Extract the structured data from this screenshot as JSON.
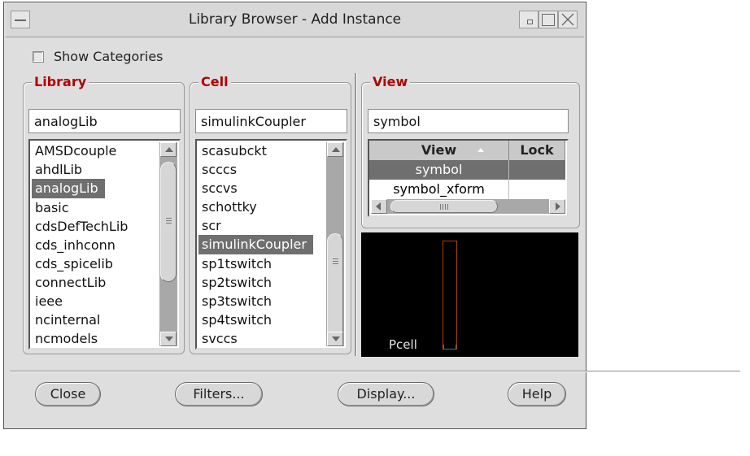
{
  "window": {
    "title": "Library Browser - Add Instance"
  },
  "show_categories": {
    "label": "Show Categories",
    "checked": false
  },
  "library": {
    "heading": "Library",
    "field_value": "analogLib",
    "items": [
      "AMSDcouple",
      "ahdlLib",
      "analogLib",
      "basic",
      "cdsDefTechLib",
      "cds_inhconn",
      "cds_spicelib",
      "connectLib",
      "ieee",
      "ncinternal",
      "ncmodels"
    ],
    "selected": "analogLib"
  },
  "cell": {
    "heading": "Cell",
    "field_value": "simulinkCoupler",
    "items": [
      "scasubckt",
      "scccs",
      "sccvs",
      "schottky",
      "scr",
      "simulinkCoupler",
      "sp1tswitch",
      "sp2tswitch",
      "sp3tswitch",
      "sp4tswitch",
      "svccs"
    ],
    "selected": "simulinkCoupler"
  },
  "view": {
    "heading": "View",
    "field_value": "symbol",
    "columns": [
      "View",
      "Lock"
    ],
    "rows": [
      {
        "view": "symbol",
        "lock": ""
      },
      {
        "view": "symbol_xform",
        "lock": ""
      }
    ],
    "selected": "symbol"
  },
  "preview": {
    "label": "Pcell"
  },
  "buttons": {
    "close": "Close",
    "filters": "Filters...",
    "display": "Display...",
    "help": "Help"
  }
}
